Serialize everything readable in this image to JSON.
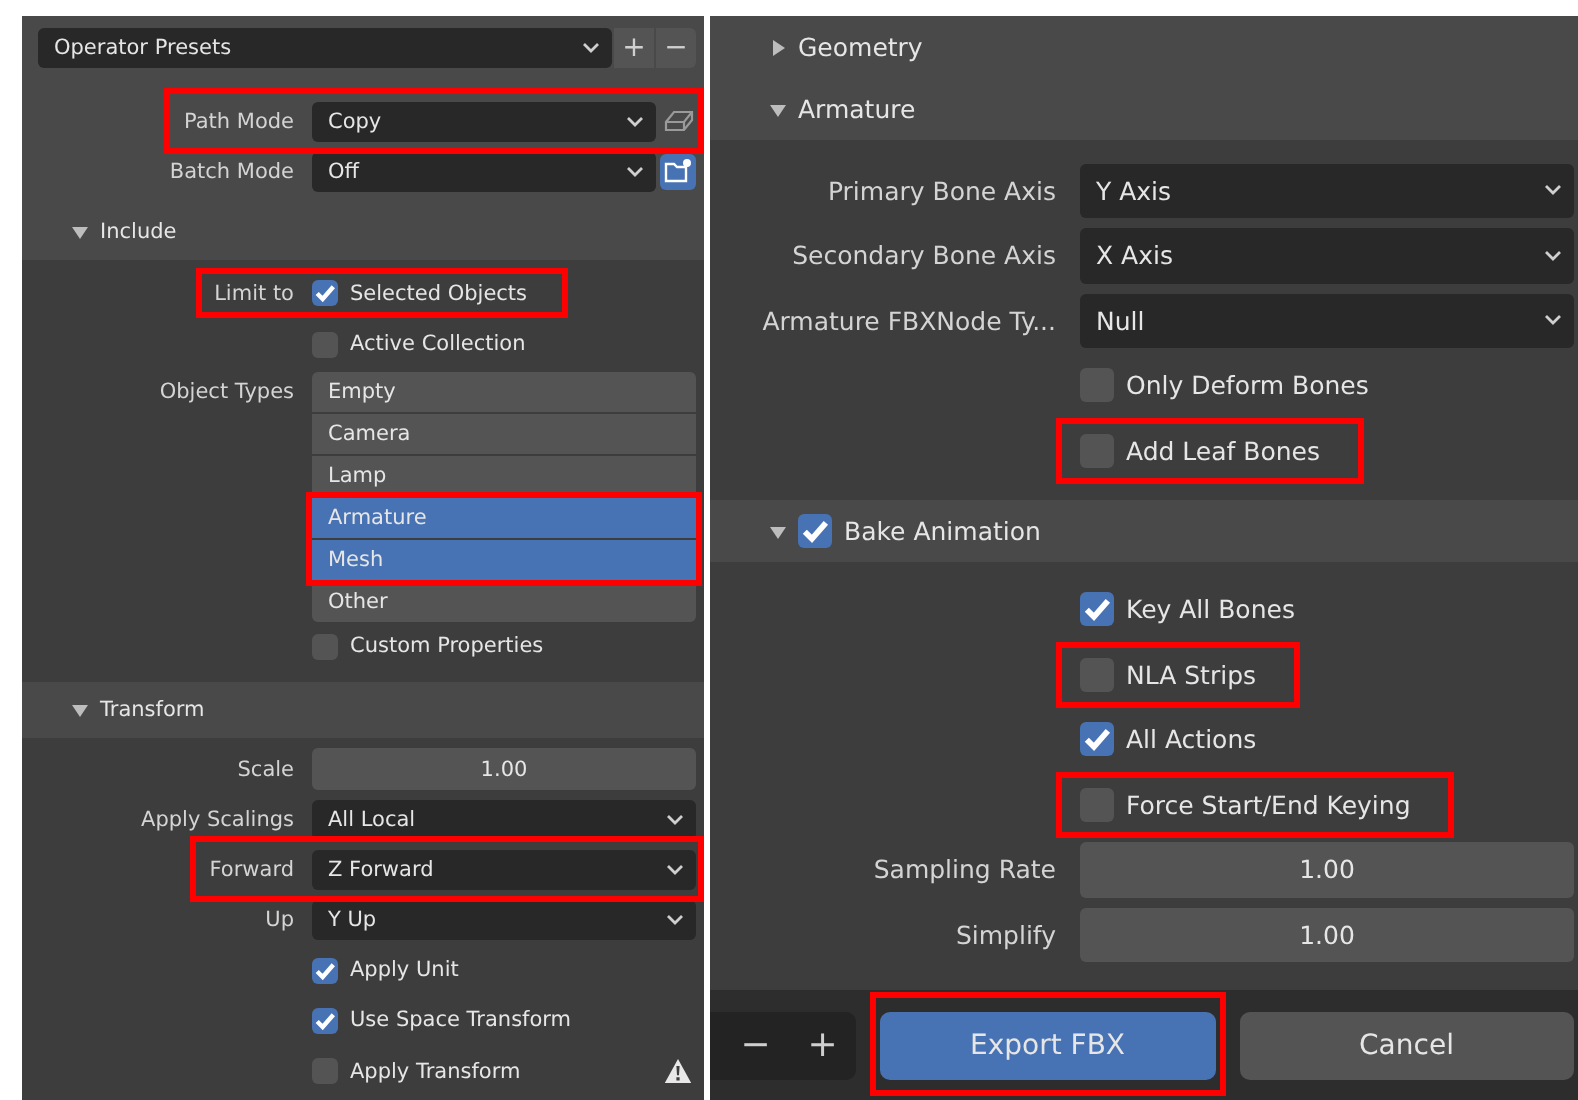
{
  "left": {
    "sections": [
      {
        "rows": [
          {
            "kind": "presets",
            "value": "Operator Presets",
            "buttons": [
              "+",
              "−"
            ]
          },
          {
            "kind": "dropdown-toggle",
            "label": "Path Mode",
            "value": "Copy",
            "highlighted": true
          },
          {
            "kind": "dropdown-browse",
            "label": "Batch Mode",
            "value": "Off",
            "highlighted": false
          }
        ]
      },
      {
        "title": "Include",
        "expanded": true,
        "rows": [
          {
            "kind": "checkbox",
            "label": "Limit to",
            "text": "Selected Objects",
            "checked": true,
            "highlighted": true
          },
          {
            "kind": "checkbox",
            "text": "Active Collection",
            "checked": false,
            "highlighted": false
          },
          {
            "kind": "list",
            "label": "Object Types",
            "items": [
              {
                "text": "Empty",
                "selected": false,
                "highlighted": false
              },
              {
                "text": "Camera",
                "selected": false,
                "highlighted": false
              },
              {
                "text": "Lamp",
                "selected": false,
                "highlighted": false
              },
              {
                "text": "Armature",
                "selected": true,
                "highlighted": true
              },
              {
                "text": "Mesh",
                "selected": true,
                "highlighted": true
              },
              {
                "text": "Other",
                "selected": false,
                "highlighted": false
              }
            ]
          },
          {
            "kind": "checkbox",
            "text": "Custom Properties",
            "checked": false,
            "highlighted": false
          }
        ]
      },
      {
        "title": "Transform",
        "expanded": true,
        "rows": [
          {
            "kind": "number",
            "label": "Scale",
            "value": "1.00",
            "highlighted": false
          },
          {
            "kind": "dropdown",
            "label": "Apply Scalings",
            "value": "All Local",
            "highlighted": false
          },
          {
            "kind": "dropdown",
            "label": "Forward",
            "value": "Z Forward",
            "highlighted": true
          },
          {
            "kind": "dropdown",
            "label": "Up",
            "value": "Y Up",
            "highlighted": false
          },
          {
            "kind": "checkbox",
            "text": "Apply Unit",
            "checked": true,
            "highlighted": false
          },
          {
            "kind": "checkbox",
            "text": "Use Space Transform",
            "checked": true,
            "highlighted": false
          },
          {
            "kind": "checkbox",
            "text": "Apply Transform",
            "checked": false,
            "highlighted": false,
            "warning": true
          }
        ]
      }
    ]
  },
  "right": {
    "sections": [
      {
        "title": "Geometry",
        "expanded": false
      },
      {
        "title": "Armature",
        "expanded": true,
        "rows": [
          {
            "kind": "dropdown",
            "label": "Primary Bone Axis",
            "value": "Y Axis",
            "highlighted": false
          },
          {
            "kind": "dropdown",
            "label": "Secondary Bone Axis",
            "value": "X Axis",
            "highlighted": false
          },
          {
            "kind": "dropdown",
            "label": "Armature FBXNode Ty...",
            "value": "Null",
            "highlighted": false
          },
          {
            "kind": "checkbox",
            "text": "Only Deform Bones",
            "checked": false,
            "highlighted": false
          },
          {
            "kind": "checkbox",
            "text": "Add Leaf Bones",
            "checked": false,
            "highlighted": true
          }
        ]
      },
      {
        "title": "Bake Animation",
        "expanded": true,
        "checked": true,
        "rows": [
          {
            "kind": "checkbox",
            "text": "Key All Bones",
            "checked": true,
            "highlighted": false
          },
          {
            "kind": "checkbox",
            "text": "NLA Strips",
            "checked": false,
            "highlighted": true
          },
          {
            "kind": "checkbox",
            "text": "All Actions",
            "checked": true,
            "highlighted": false
          },
          {
            "kind": "checkbox",
            "text": "Force Start/End Keying",
            "checked": false,
            "highlighted": true
          },
          {
            "kind": "number",
            "label": "Sampling Rate",
            "value": "1.00",
            "highlighted": false
          },
          {
            "kind": "number",
            "label": "Simplify",
            "value": "1.00",
            "highlighted": false
          }
        ]
      }
    ],
    "footer": {
      "buttons": [
        "−",
        "+"
      ],
      "actions": [
        {
          "label": "Export FBX",
          "primary": true,
          "highlighted": true
        },
        {
          "label": "Cancel",
          "primary": false,
          "highlighted": false
        }
      ]
    }
  }
}
